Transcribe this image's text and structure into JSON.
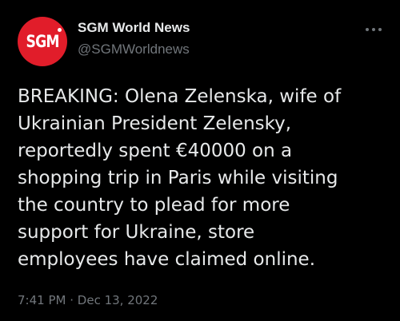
{
  "account": {
    "avatar_text": "SGM",
    "display_name": "SGM World News",
    "handle": "@SGMWorldnews"
  },
  "icons": {
    "more": "more-dots-icon"
  },
  "colors": {
    "background": "#000000",
    "avatar_brand": "#e11d2a",
    "primary_text": "#e7e9ea",
    "secondary_text": "#71767b"
  },
  "tweet": {
    "text": "BREAKING: Olena Zelenska, wife of\nUkrainian President Zelensky,\nreportedly spent €40000 on a\nshopping trip in Paris while visiting\nthe country to plead for more\nsupport for Ukraine, store\nemployees have claimed online.",
    "time": "7:41 PM",
    "separator": "·",
    "date": "Dec 13, 2022"
  }
}
